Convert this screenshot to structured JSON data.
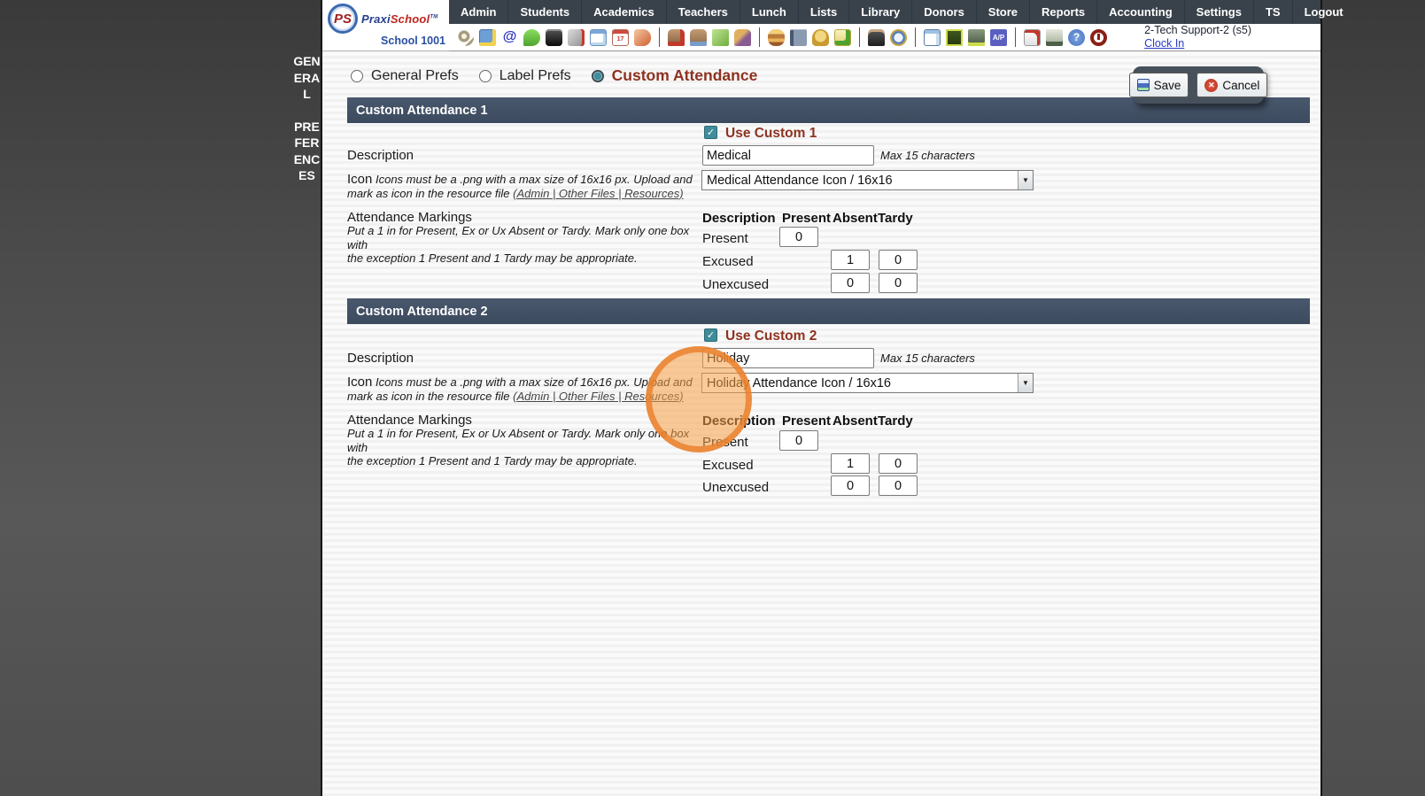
{
  "brand": {
    "monogram": "PS",
    "name_part1": "Praxi",
    "name_part2": "School",
    "tm": "TM",
    "school_label": "School 1001"
  },
  "navbar": {
    "tabs": [
      "Admin",
      "Students",
      "Academics",
      "Teachers",
      "Lunch",
      "Lists",
      "Library",
      "Donors",
      "Store",
      "Reports",
      "Accounting",
      "Settings",
      "TS",
      "Logout"
    ]
  },
  "toolbar": {
    "icons": [
      "search",
      "apps-grid",
      "email",
      "chat",
      "phone",
      "speaker",
      "calendar",
      "calendar-date",
      "megaphone",
      "nurse",
      "parent",
      "tickets",
      "family",
      "lunch",
      "binder",
      "bell",
      "note-send",
      "staff",
      "clock",
      "spreadsheet",
      "check",
      "register",
      "accounts-payable",
      "pdf",
      "print",
      "help",
      "power"
    ],
    "user_line": "2-Tech Support-2 (s5)",
    "clock_in": "Clock In"
  },
  "glyphs": {
    "check": "✓",
    "x": "✕",
    "at": "@",
    "ap": "A/P",
    "help": "?",
    "select_arrow": "▼",
    "calendar_day": "17"
  },
  "sidebar": {
    "label": "GENERAL PREFERENCES",
    "words": [
      "GENERAL",
      "PREFERENCES"
    ]
  },
  "prefs_nav": {
    "options": [
      {
        "label": "General Prefs",
        "selected": false
      },
      {
        "label": "Label Prefs",
        "selected": false
      },
      {
        "label": "Custom Attendance",
        "selected": true
      }
    ]
  },
  "actions": {
    "save": "Save",
    "cancel": "Cancel"
  },
  "colors": {
    "accent_maroon": "#8e3220",
    "section_bar": "#414e61",
    "nav_bar": "#39424b",
    "checkbox_teal": "#3f8d9b",
    "link_blue": "#2b3cc4",
    "highlight_orange": "#ed7d2a"
  },
  "sections": [
    {
      "title": "Custom Attendance 1",
      "use_label": "Use Custom 1",
      "use_checked": true,
      "description_label": "Description",
      "description_value": "Medical",
      "max_hint": "Max 15 characters",
      "icon_label": "Icon",
      "icon_help_line1": "Icons must be a .png with a max size of 16x16 px. Upload and",
      "icon_help_line2": "mark as icon in the resource file",
      "icon_help_link": "(Admin | Other Files | Resources)",
      "icon_value": "Medical Attendance Icon / 16x16",
      "markings_label": "Attendance Markings",
      "markings_help_line1": "Put a 1 in for Present, Ex or Ux Absent or Tardy. Mark only one box with",
      "markings_help_line2": "the exception 1 Present and 1 Tardy may be appropriate.",
      "table": {
        "headers": [
          "Description",
          "Present",
          "Absent",
          "Tardy"
        ],
        "rows": [
          {
            "label": "Present",
            "present": "0"
          },
          {
            "label": "Excused",
            "absent": "1",
            "tardy": "0"
          },
          {
            "label": "Unexcused",
            "absent": "0",
            "tardy": "0"
          }
        ]
      }
    },
    {
      "title": "Custom Attendance 2",
      "use_label": "Use Custom 2",
      "use_checked": true,
      "description_label": "Description",
      "description_value": "Holiday",
      "max_hint": "Max 15 characters",
      "icon_label": "Icon",
      "icon_help_line1": "Icons must be a .png with a max size of 16x16 px. Upload and",
      "icon_help_line2": "mark as icon in the resource file",
      "icon_help_link": "(Admin | Other Files | Resources)",
      "icon_value": "Holiday Attendance Icon / 16x16",
      "markings_label": "Attendance Markings",
      "markings_help_line1": "Put a 1 in for Present, Ex or Ux Absent or Tardy. Mark only one box with",
      "markings_help_line2": "the exception 1 Present and 1 Tardy may be appropriate.",
      "table": {
        "headers": [
          "Description",
          "Present",
          "Absent",
          "Tardy"
        ],
        "rows": [
          {
            "label": "Present",
            "present": "0"
          },
          {
            "label": "Excused",
            "absent": "1",
            "tardy": "0"
          },
          {
            "label": "Unexcused",
            "absent": "0",
            "tardy": "0"
          }
        ]
      }
    }
  ]
}
